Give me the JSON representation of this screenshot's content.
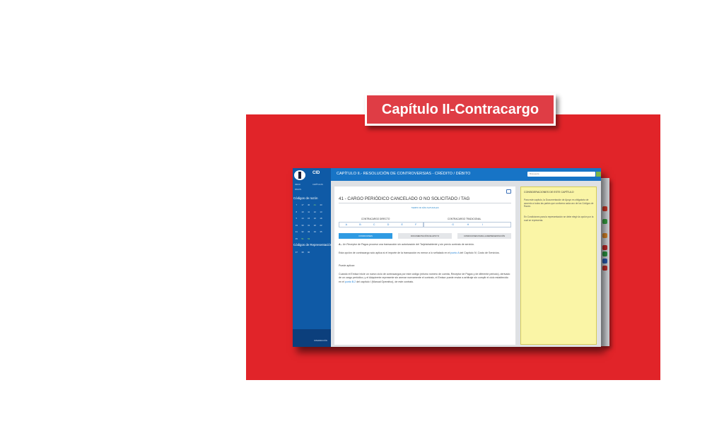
{
  "title": "Capítulo II-Contracargo",
  "colors": {
    "banner": "#e12429",
    "title_bg": "#df3d45",
    "sidebar": "#0f5aa6",
    "topbar": "#1774c6",
    "note_bg": "#faf5a6",
    "link": "#1b7fd6"
  },
  "app": {
    "brand": "CID",
    "header": "CAPÍTULO II.- RESOLUCIÓN DE CONTROVERSIAS - CRÉDITO / DÉBITO",
    "search_placeholder": "Búsqueda",
    "sidebar": {
      "nav_1": "INICIO",
      "nav_2": "CAPÍTULOS",
      "nav_3": "PAGOS",
      "section_1": "Códigos de razón",
      "codes_1": [
        "7",
        "17",
        "40",
        "41",
        "43",
        "",
        "8",
        "10",
        "11",
        "12",
        "13",
        "",
        "5",
        "14",
        "15",
        "16",
        "18",
        "",
        "19",
        "30",
        "31",
        "20",
        "22",
        "",
        "31",
        "32",
        "33",
        "34",
        "35",
        "",
        "35",
        "51",
        "53",
        "",
        "",
        ""
      ],
      "section_2": "Códigos de Representación",
      "codes_2": [
        "37",
        "38",
        "90",
        "",
        "",
        ""
      ],
      "footer_1": "TRIZN",
      "footer_2": "GLOSARIO",
      "footer_3": "INTERDICCIÓN"
    },
    "main": {
      "title": "41 - CARGO PERIÓDICO CANCELADO O NO SOLICITADO / TAG",
      "subtitle": "TIEMPO 90 DÍAS NATURALES",
      "direct_label": "CONTRACARGO DIRECTO",
      "direct_letters": [
        "A",
        "B",
        "C",
        "D",
        "E",
        "F"
      ],
      "traditional_label": "CONTRACARGO TRADICIONAL",
      "traditional_letters": [
        "G",
        "H",
        "I"
      ],
      "tabs": [
        "CONDICIONES",
        "DOCUMENTACIÓN DE APOYO",
        "CONDICIONES PARA LA REPRESENTACIÓN"
      ],
      "p1_lead": "A.-",
      "p1": "Un Receptor de Pagos procesó una transacción sin autorización del Tarjetahabiente y sin previo contrato de servicio.",
      "p2_a": "Esta opción de contracargo solo aplica si el importe de la transacción es menor a lo señalado en el",
      "p2_link": "punto A",
      "p2_b": "del Capítulo IV, Costo de Servicios.",
      "p3": "Puede aplicar:",
      "p4_a": "Cuando el Emisor inicie un nuevo ciclo de contracargos por este código (mismo número de cuenta, Receptor de Pagos y de diferente periodo), derivado de un cargo periódico, y el Adquirente represente sin anexar nuevamente el contrato, el Emisor puede enviar a arbitraje sin cumplir el ciclo establecido en el",
      "p4_link": "punto B.2",
      "p4_b": "del capítulo I (Manual Operativo), de este contrato."
    },
    "note": {
      "heading": "CONSIDERACIONES DE ESTE CAPÍTULO",
      "p1": "Para este capítulo, la Documentación de Apoyo es obligatoria de acuerdo a todos las partes que conforma cada uno de los Códigos de Razón.",
      "p2": "En Condiciones para la representación se debe elegir la opción por la cual se representa."
    }
  }
}
